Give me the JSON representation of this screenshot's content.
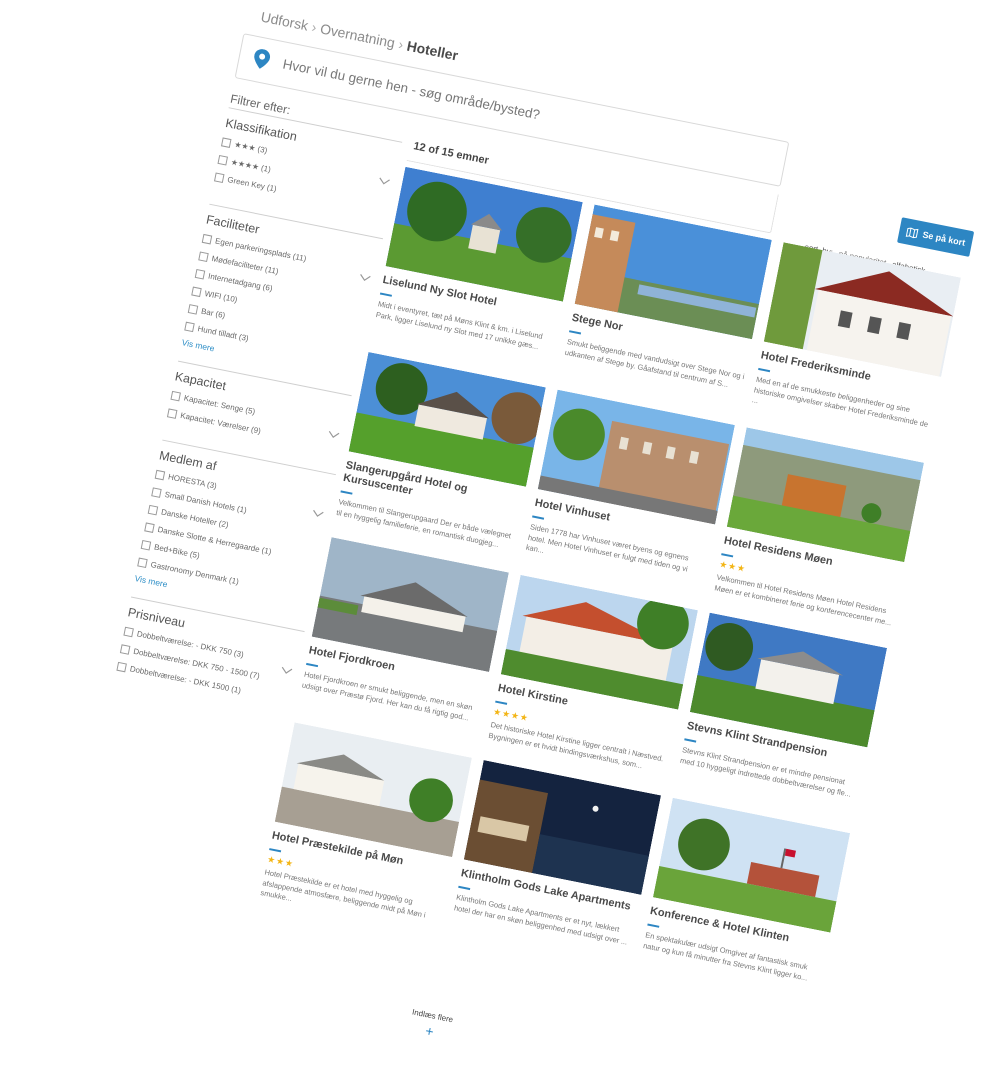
{
  "breadcrumb": {
    "items": [
      "Udforsk",
      "Overnatning"
    ],
    "current": "Hoteller"
  },
  "search": {
    "placeholder": "Hvor vil du gerne hen - søg område/bysted?"
  },
  "filters": {
    "title": "Filtrer efter:",
    "groups": [
      {
        "name": "Klassifikation",
        "options": [
          "★★★ (3)",
          "★★★★ (1)",
          "Green Key (1)"
        ]
      },
      {
        "name": "Faciliteter",
        "options": [
          "Egen parkeringsplads (11)",
          "Mødefaciliteter (11)",
          "Internetadgang (6)",
          "WIFI (10)",
          "Bar (6)",
          "Hund tilladt (3)"
        ],
        "more": "Vis mere"
      },
      {
        "name": "Kapacitet",
        "options": [
          "Kapacitet: Senge (5)",
          "Kapacitet: Værelser (9)"
        ]
      },
      {
        "name": "Medlem af",
        "options": [
          "HORESTA (3)",
          "Small Danish Hotels (1)",
          "Danske Hoteller (2)",
          "Danske Slotte & Herregaarde (1)",
          "Bed+Bike (5)",
          "Gastronomy Denmark (1)"
        ],
        "more": "Vis mere"
      },
      {
        "name": "Prisniveau",
        "options": [
          "Dobbeltværelse: - DKK 750 (3)",
          "Dobbeltværelse: DKK 750 - 1500 (7)",
          "Dobbeltværelse: - DKK 1500 (1)"
        ]
      }
    ]
  },
  "results": {
    "count": "12 of 15 emner"
  },
  "map_button": {
    "label": "Se på kort"
  },
  "sort": {
    "label": "sort_by:",
    "options": [
      "på popularitet",
      "alfabetisk"
    ]
  },
  "hotels": [
    {
      "name": "Liselund Ny Slot Hotel",
      "stars": "",
      "desc": "Midt i eventyret, tæt på Møns Klint & km. i Liselund Park, ligger Liselund ny Slot med 17 unikke gæs..."
    },
    {
      "name": "Stege Nor",
      "stars": "",
      "desc": "Smukt beliggende med vandudsigt over Stege Nor og i udkanten af Stege by. Gåafstand til centrum af S..."
    },
    {
      "name": "Hotel Frederiksminde",
      "stars": "",
      "desc": "Med en af de smukkeste beliggenheder og sine historiske omgivelser skaber Hotel Frederiksminde de ..."
    },
    {
      "name": "Slangerupgård Hotel og Kursuscenter",
      "stars": "",
      "desc": "Velkommen til Slangerupgaard Der er både vælegnet til en hyggelig familieferie, en romantisk duogjeg..."
    },
    {
      "name": "Hotel Vinhuset",
      "stars": "",
      "desc": "Siden 1778 har Vinhuset været byens og egnens hotel. Men Hotel Vinhuset er fulgt med tiden og vi kan..."
    },
    {
      "name": "Hotel Residens Møen",
      "stars": "★★★",
      "desc": "Velkommen til Hotel Residens Møen Hotel Residens Møen er et kombineret ferie og konferencecenter me..."
    },
    {
      "name": "Hotel Fjordkroen",
      "stars": "",
      "desc": "Hotel Fjordkroen er smukt beliggende, men en skøn udsigt over Præstø Fjord. Her kan du få rigtig god..."
    },
    {
      "name": "Hotel Kirstine",
      "stars": "★★★★",
      "desc": "Det historiske Hotel Kirstine ligger centralt i Næstved. Bygningen er et hvidt bindingsværkshus, som..."
    },
    {
      "name": "Stevns Klint Strandpension",
      "stars": "",
      "desc": "Stevns Klint Strandpension er et mindre pensionat med 10 hyggeligt indrettede dobbeltværelser og fle..."
    },
    {
      "name": "Hotel Præstekilde på Møn",
      "stars": "★★★",
      "desc": "Hotel Præstekilde er et hotel med hyggelig og afslappende atmosfære, beliggende midt på Møn i smukke..."
    },
    {
      "name": "Klintholm Gods Lake Apartments",
      "stars": "",
      "desc": "Klintholm Gods Lake Apartments er et nyt, lækkert hotel der har en skøn beliggenhed med udsigt over ..."
    },
    {
      "name": "Konference & Hotel Klinten",
      "stars": "",
      "desc": "En spektakulær udsigt Omgivet af fantastisk smuk natur og kun få minutter fra Stevns Klint ligger ko..."
    }
  ],
  "load_more": {
    "label": "Indlæs flere",
    "plus": "+"
  },
  "colors": {
    "accent": "#2d86c3",
    "star": "#f3b515"
  }
}
